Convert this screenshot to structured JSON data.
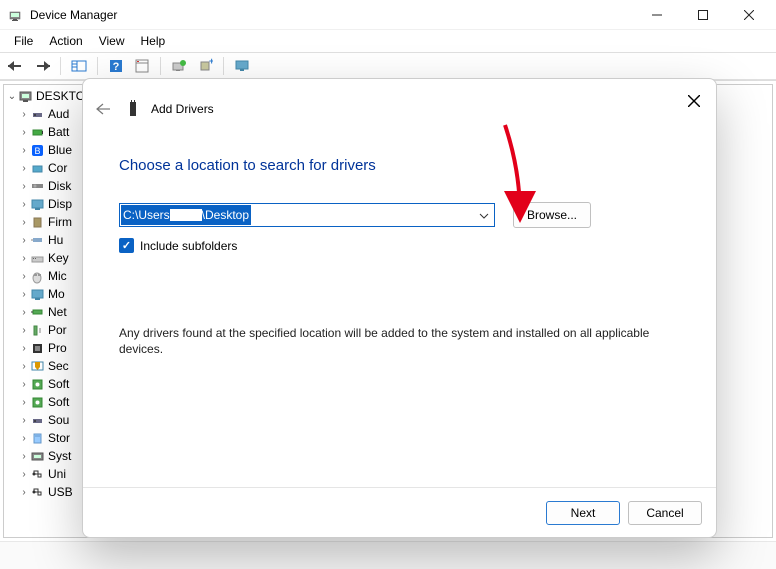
{
  "window": {
    "title": "Device Manager"
  },
  "menu": {
    "file": "File",
    "action": "Action",
    "view": "View",
    "help": "Help"
  },
  "tree": {
    "root": "DESKTO",
    "items": [
      {
        "label": "Aud"
      },
      {
        "label": "Batt"
      },
      {
        "label": "Blue"
      },
      {
        "label": "Cor"
      },
      {
        "label": "Disk"
      },
      {
        "label": "Disp"
      },
      {
        "label": "Firm"
      },
      {
        "label": "Hu"
      },
      {
        "label": "Key"
      },
      {
        "label": "Mic"
      },
      {
        "label": "Mo"
      },
      {
        "label": "Net"
      },
      {
        "label": "Por"
      },
      {
        "label": "Pro"
      },
      {
        "label": "Sec"
      },
      {
        "label": "Soft"
      },
      {
        "label": "Soft"
      },
      {
        "label": "Sou"
      },
      {
        "label": "Stor"
      },
      {
        "label": "Syst"
      },
      {
        "label": "Uni"
      },
      {
        "label": "USB"
      }
    ]
  },
  "dialog": {
    "title": "Add Drivers",
    "heading": "Choose a location to search for drivers",
    "path_prefix": "C:\\Users",
    "path_suffix": "\\Desktop",
    "browse": "Browse...",
    "include_subfolders": "Include subfolders",
    "description": "Any drivers found at the specified location will be added to the system and installed on all applicable devices.",
    "next": "Next",
    "cancel": "Cancel"
  }
}
